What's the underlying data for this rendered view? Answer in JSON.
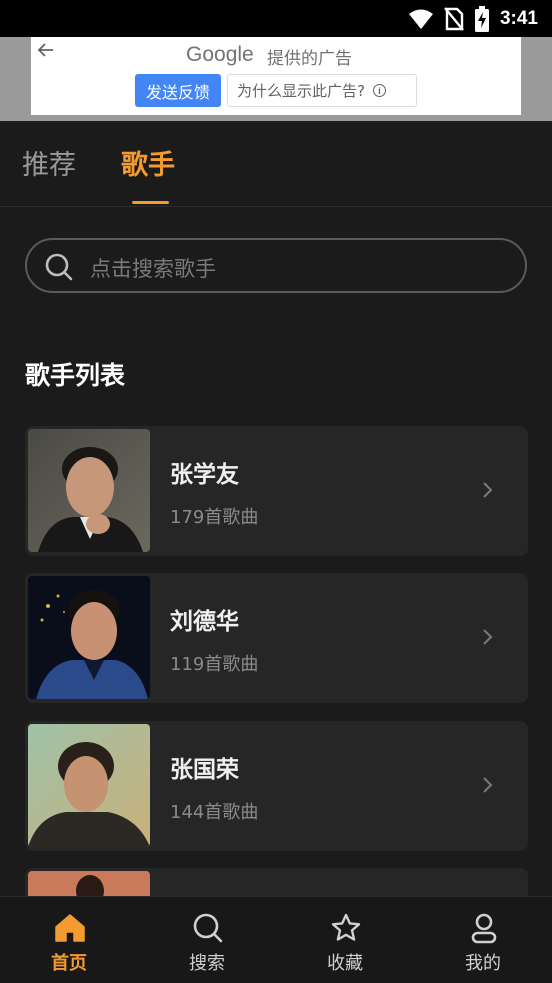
{
  "status_bar": {
    "time": "3:41"
  },
  "ad": {
    "brand": "Google",
    "caption": "提供的广告",
    "feedback_label": "发送反馈",
    "why_label": "为什么显示此广告?",
    "info_glyph": "i"
  },
  "tabs": [
    {
      "label": "推荐",
      "active": false
    },
    {
      "label": "歌手",
      "active": true
    }
  ],
  "search": {
    "placeholder": "点击搜索歌手"
  },
  "section": {
    "title": "歌手列表"
  },
  "singers": [
    {
      "name": "张学友",
      "count": "179首歌曲"
    },
    {
      "name": "刘德华",
      "count": "119首歌曲"
    },
    {
      "name": "张国荣",
      "count": "144首歌曲"
    },
    {
      "name": "",
      "count": ""
    }
  ],
  "bottom_nav": [
    {
      "label": "首页",
      "icon": "home-icon",
      "active": true
    },
    {
      "label": "搜索",
      "icon": "search-icon",
      "active": false
    },
    {
      "label": "收藏",
      "icon": "star-icon",
      "active": false
    },
    {
      "label": "我的",
      "icon": "user-icon",
      "active": false
    }
  ],
  "colors": {
    "accent": "#f39a30",
    "background": "#1b1b1b",
    "card": "#262626"
  }
}
